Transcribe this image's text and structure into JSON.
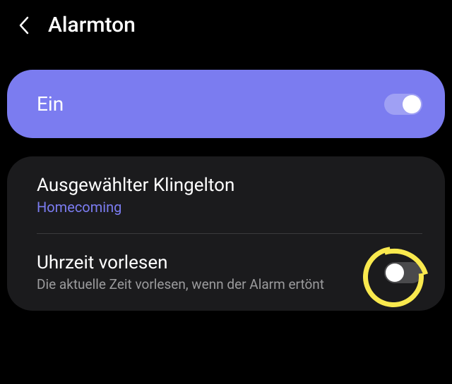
{
  "header": {
    "title": "Alarmton"
  },
  "main_toggle": {
    "label": "Ein",
    "state": "on"
  },
  "settings": {
    "ringtone": {
      "title": "Ausgewählter Klingelton",
      "value": "Homecoming"
    },
    "read_time": {
      "title": "Uhrzeit vorlesen",
      "subtitle": "Die aktuelle Zeit vorlesen, wenn der Alarm ertönt",
      "state": "off"
    }
  },
  "colors": {
    "accent": "#7b7cf0",
    "annotation": "#f9e94e"
  }
}
